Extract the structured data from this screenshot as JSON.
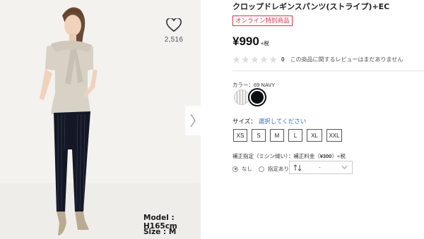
{
  "gallery": {
    "favorite_count": "2,516",
    "model_height": "Model : H165cm",
    "model_size": "Size : M"
  },
  "product": {
    "title": "クロップドレギンスパンツ(ストライプ)+EC",
    "badge": "オンライン特別商品",
    "price": "¥990",
    "tax_label": "+税",
    "review_count": "0",
    "review_message": "この商品に関するレビューはまだありません",
    "rating": 0,
    "color_label": "カラー：69 NAVY",
    "size_label": "サイズ：",
    "size_prompt": "選択してください",
    "sizes": [
      "XS",
      "S",
      "M",
      "L",
      "XL",
      "XXL"
    ],
    "hem_label_prefix": "補正指定（ミシン縫い）：補正料金（",
    "hem_fee": "¥300",
    "hem_label_suffix": "）+税",
    "hem_options": [
      "なし",
      "指定あり"
    ],
    "hem_select_value": "-"
  },
  "colors": {
    "badge": "#d8334a",
    "link": "#3b6fb6",
    "selected_swatch": "#0d0f17"
  },
  "icons": [
    "heart-icon",
    "chevron-right-icon",
    "star-icon",
    "sort-icon",
    "chevron-down-icon"
  ]
}
